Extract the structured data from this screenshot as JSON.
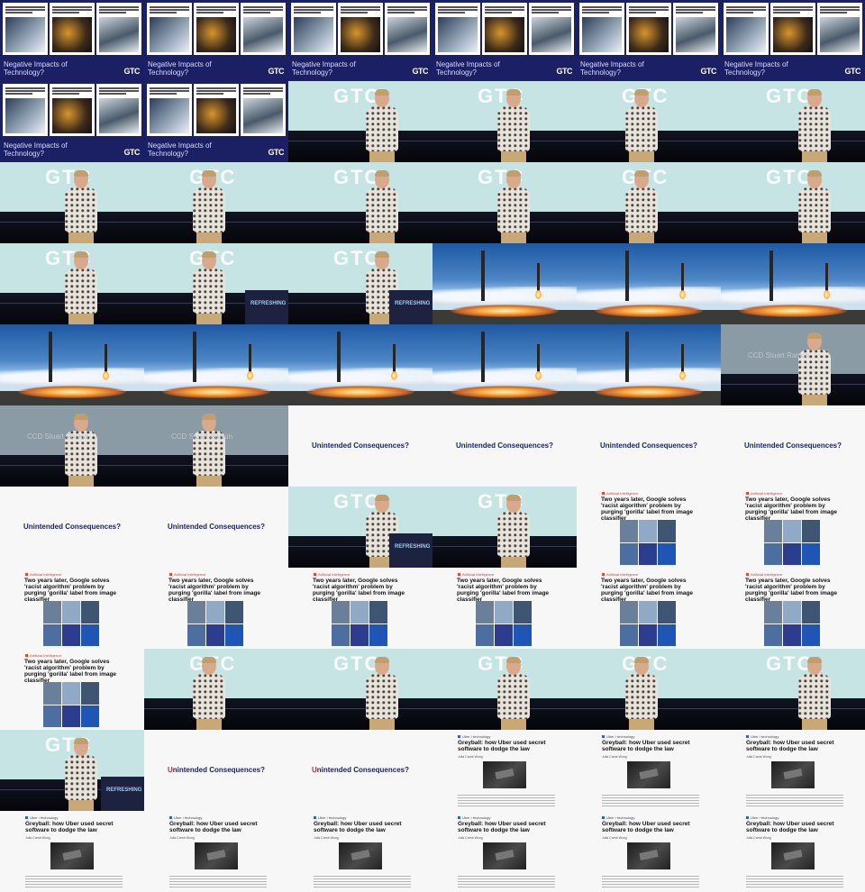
{
  "layout": "contact-sheet",
  "columns": 6,
  "rows": 11,
  "logo_text": "GTC",
  "podium_text": "REFRESHING",
  "credit_text": "CCD Stuart Rankin",
  "text": {
    "negative": "Negative Impacts of Technology?",
    "unintended": "Unintended Consequences?",
    "unintended_first": "U",
    "unintended_rest": "nintended Consequences?",
    "google_tag": "Artificial Intelligence",
    "google_headline": "Two years later, Google solves 'racist algorithm' problem by purging 'gorilla' label from image classifier",
    "uber_tag": "Uber / technology",
    "uber_headline": "Greyball: how Uber used secret software to dodge the law",
    "uber_byline": "Julia Carrie Wong"
  },
  "cells": [
    "neg",
    "neg",
    "neg",
    "neg",
    "neg",
    "neg",
    "neg",
    "neg",
    "stage",
    "stage",
    "stage",
    "stage",
    "stage",
    "stage",
    "stage",
    "stage",
    "stage",
    "stage",
    "stage",
    "stage-podium",
    "stage-podium",
    "rocket",
    "rocket",
    "rocket",
    "rocket",
    "rocket",
    "rocket",
    "rocket",
    "rocket",
    "stage-gray-credit",
    "stage-gray-credit",
    "stage-gray-credit",
    "title",
    "title",
    "title",
    "title",
    "title",
    "title",
    "stage-podium",
    "stage",
    "google",
    "google",
    "google",
    "google",
    "google",
    "google",
    "google",
    "google",
    "google",
    "stage",
    "stage",
    "stage",
    "stage",
    "stage",
    "stage-podium",
    "title-red",
    "title-red",
    "uber",
    "uber",
    "uber",
    "uber",
    "uber",
    "uber",
    "uber",
    "uber",
    "uber"
  ]
}
